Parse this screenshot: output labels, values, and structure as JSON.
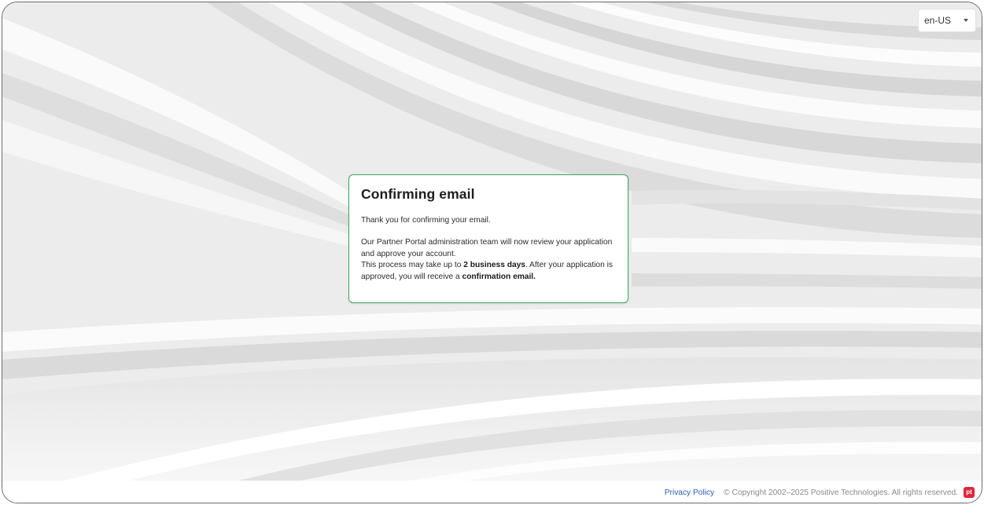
{
  "language_selector": {
    "value": "en-US"
  },
  "card": {
    "title": "Confirming email",
    "thanks": "Thank you for confirming your email.",
    "body_line_1": "Our Partner Portal administration team will now review your application and approve your account.",
    "body_line_2_prefix": "This process may take up to ",
    "body_line_2_bold": "2 business days",
    "body_line_2_middle": ". After your application is approved, you will receive a ",
    "body_line_2_bold_2": "confirmation email.",
    "border_color": "#3aa55e"
  },
  "footer": {
    "privacy_label": "Privacy Policy",
    "copyright": "© Copyright 2002–2025 Positive Technologies. All rights reserved.",
    "logo_text": "pt",
    "logo_color": "#e0283a",
    "link_color": "#2a5db8"
  }
}
